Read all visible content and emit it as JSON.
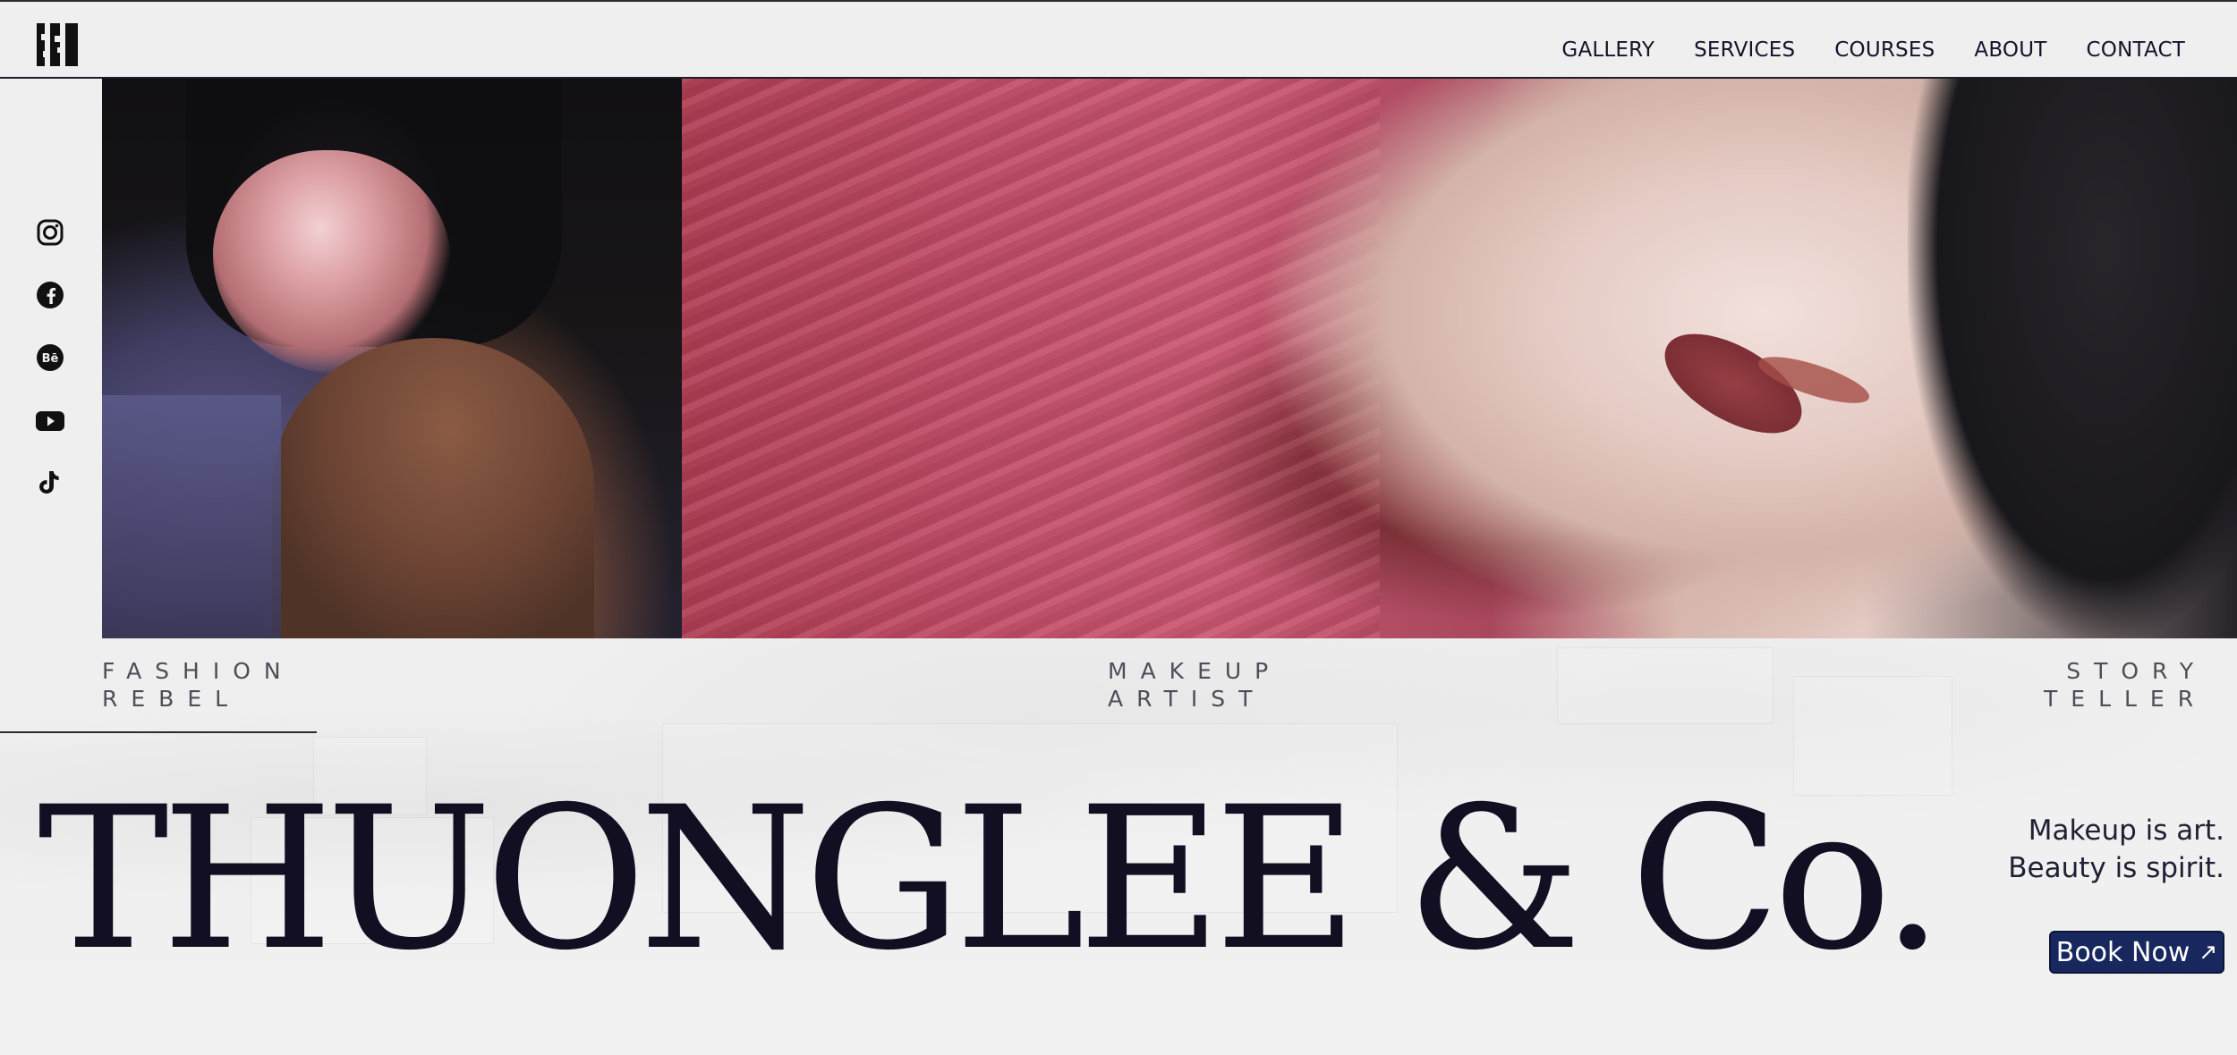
{
  "header": {
    "logo_name": "brand-logo",
    "nav": [
      {
        "label": "GALLERY"
      },
      {
        "label": "SERVICES"
      },
      {
        "label": "COURSES"
      },
      {
        "label": "ABOUT"
      },
      {
        "label": "CONTACT"
      }
    ]
  },
  "social": [
    {
      "icon": "instagram-icon"
    },
    {
      "icon": "facebook-icon"
    },
    {
      "icon": "behance-icon"
    },
    {
      "icon": "youtube-icon"
    },
    {
      "icon": "tiktok-icon"
    }
  ],
  "hero": {
    "taglines": {
      "left_1": "FASHION",
      "left_2": "REBEL",
      "center_1": "MAKEUP",
      "center_2": "ARTIST",
      "right_1": "STORY",
      "right_2": "TELLER"
    },
    "title": "THUONGLEE & Co.",
    "motto_line_1": "Makeup is art.",
    "motto_line_2": "Beauty is spirit.",
    "cta_label": "Book Now"
  },
  "colors": {
    "background": "#efefef",
    "text_primary": "#12102a",
    "button_bg": "#18285f"
  }
}
